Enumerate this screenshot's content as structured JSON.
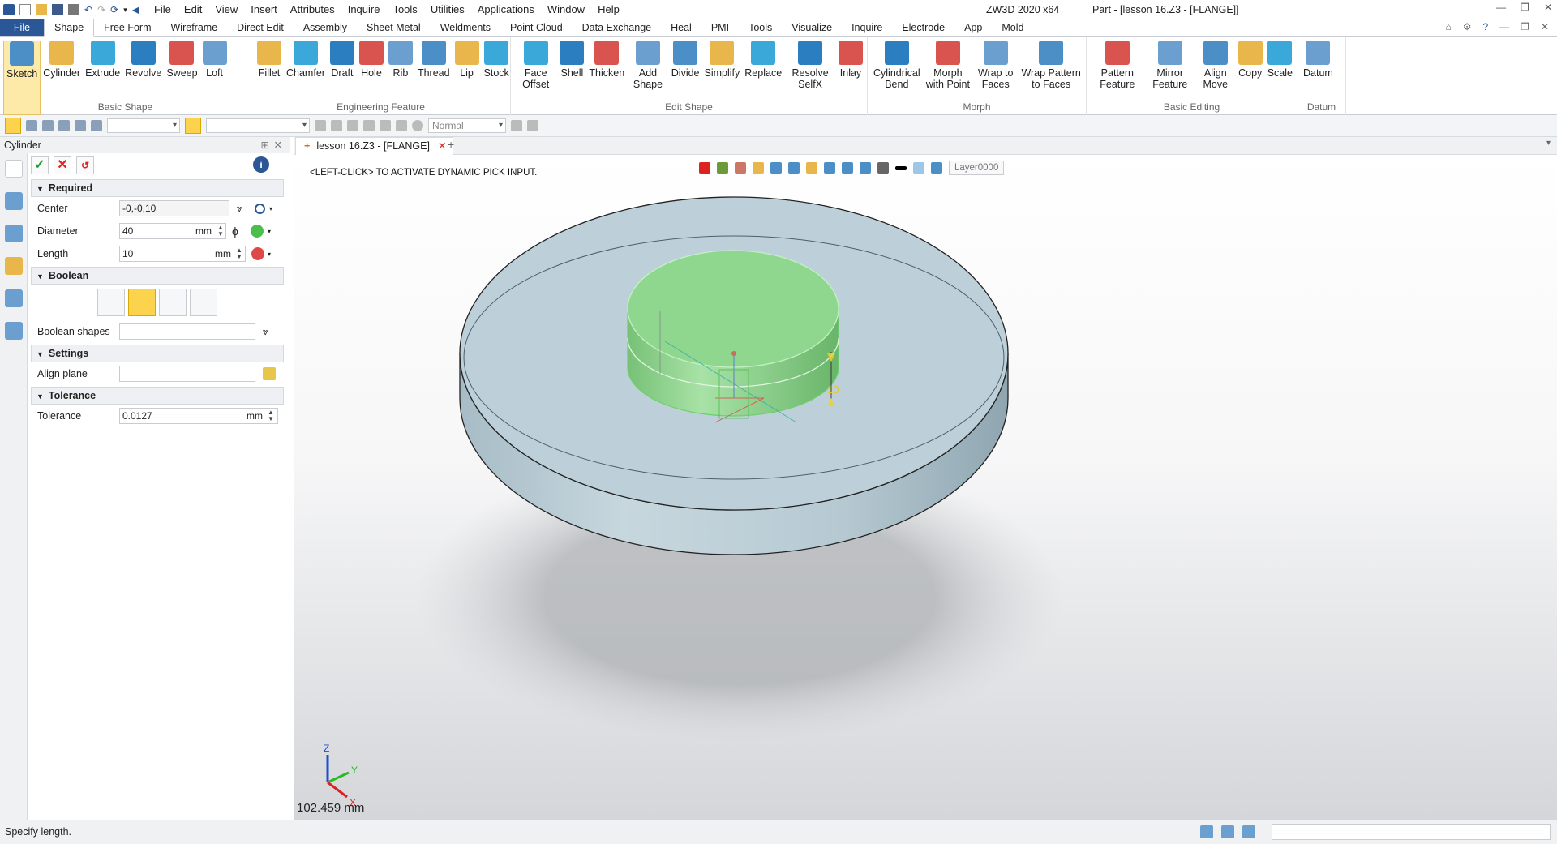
{
  "titlebar": {
    "menus": [
      "File",
      "Edit",
      "View",
      "Insert",
      "Attributes",
      "Inquire",
      "Tools",
      "Utilities",
      "Applications",
      "Window",
      "Help"
    ],
    "app_version": "ZW3D 2020 x64",
    "document_title": "Part - [lesson 16.Z3 - [FLANGE]]"
  },
  "ribbon_tabs": [
    "File",
    "Shape",
    "Free Form",
    "Wireframe",
    "Direct Edit",
    "Assembly",
    "Sheet Metal",
    "Weldments",
    "Point Cloud",
    "Data Exchange",
    "Heal",
    "PMI",
    "Tools",
    "Visualize",
    "Inquire",
    "Electrode",
    "App",
    "Mold"
  ],
  "ribbon_groups": [
    {
      "label": "Basic Shape",
      "buttons": [
        "Sketch",
        "Cylinder",
        "Extrude",
        "Revolve",
        "Sweep",
        "Loft"
      ]
    },
    {
      "label": "Engineering Feature",
      "buttons": [
        "Fillet",
        "Chamfer",
        "Draft",
        "Hole",
        "Rib",
        "Thread",
        "Lip",
        "Stock"
      ]
    },
    {
      "label": "Edit Shape",
      "buttons": [
        "Face Offset",
        "Shell",
        "Thicken",
        "Add Shape",
        "Divide",
        "Simplify",
        "Replace",
        "Resolve SelfX",
        "Inlay"
      ]
    },
    {
      "label": "Morph",
      "buttons": [
        "Cylindrical Bend",
        "Morph with Point",
        "Wrap to Faces",
        "Wrap Pattern to Faces"
      ]
    },
    {
      "label": "Basic Editing",
      "buttons": [
        "Pattern Feature",
        "Mirror Feature",
        "Align Move",
        "Copy",
        "Scale"
      ]
    },
    {
      "label": "Datum",
      "buttons": [
        "Datum"
      ]
    }
  ],
  "toolbar2": {
    "render_mode": "Normal"
  },
  "panel": {
    "title": "Cylinder",
    "sections": {
      "required": "Required",
      "boolean": "Boolean",
      "settings": "Settings",
      "tolerance": "Tolerance"
    },
    "fields": {
      "center_label": "Center",
      "center_value": "-0,-0,10",
      "diameter_label": "Diameter",
      "diameter_value": "40",
      "diameter_unit": "mm",
      "length_label": "Length",
      "length_value": "10",
      "length_unit": "mm",
      "boolean_shapes_label": "Boolean shapes",
      "align_plane_label": "Align plane",
      "tolerance_label": "Tolerance",
      "tolerance_value": "0.0127",
      "tolerance_unit": "mm"
    }
  },
  "document_tab": "lesson 16.Z3 - [FLANGE]",
  "viewport": {
    "prompt": "<LEFT-CLICK> TO ACTIVATE DYNAMIC PICK INPUT.",
    "layer": "Layer0000",
    "dimension_label": "10",
    "readout": "102.459 mm",
    "axis_labels": {
      "x": "X",
      "y": "Y",
      "z": "Z"
    }
  },
  "status": "Specify length.",
  "colors": {
    "accent": "#2b5797",
    "body": "#b9cfd9",
    "preview": "#8fd68f",
    "highlight": "#fbd34d"
  }
}
